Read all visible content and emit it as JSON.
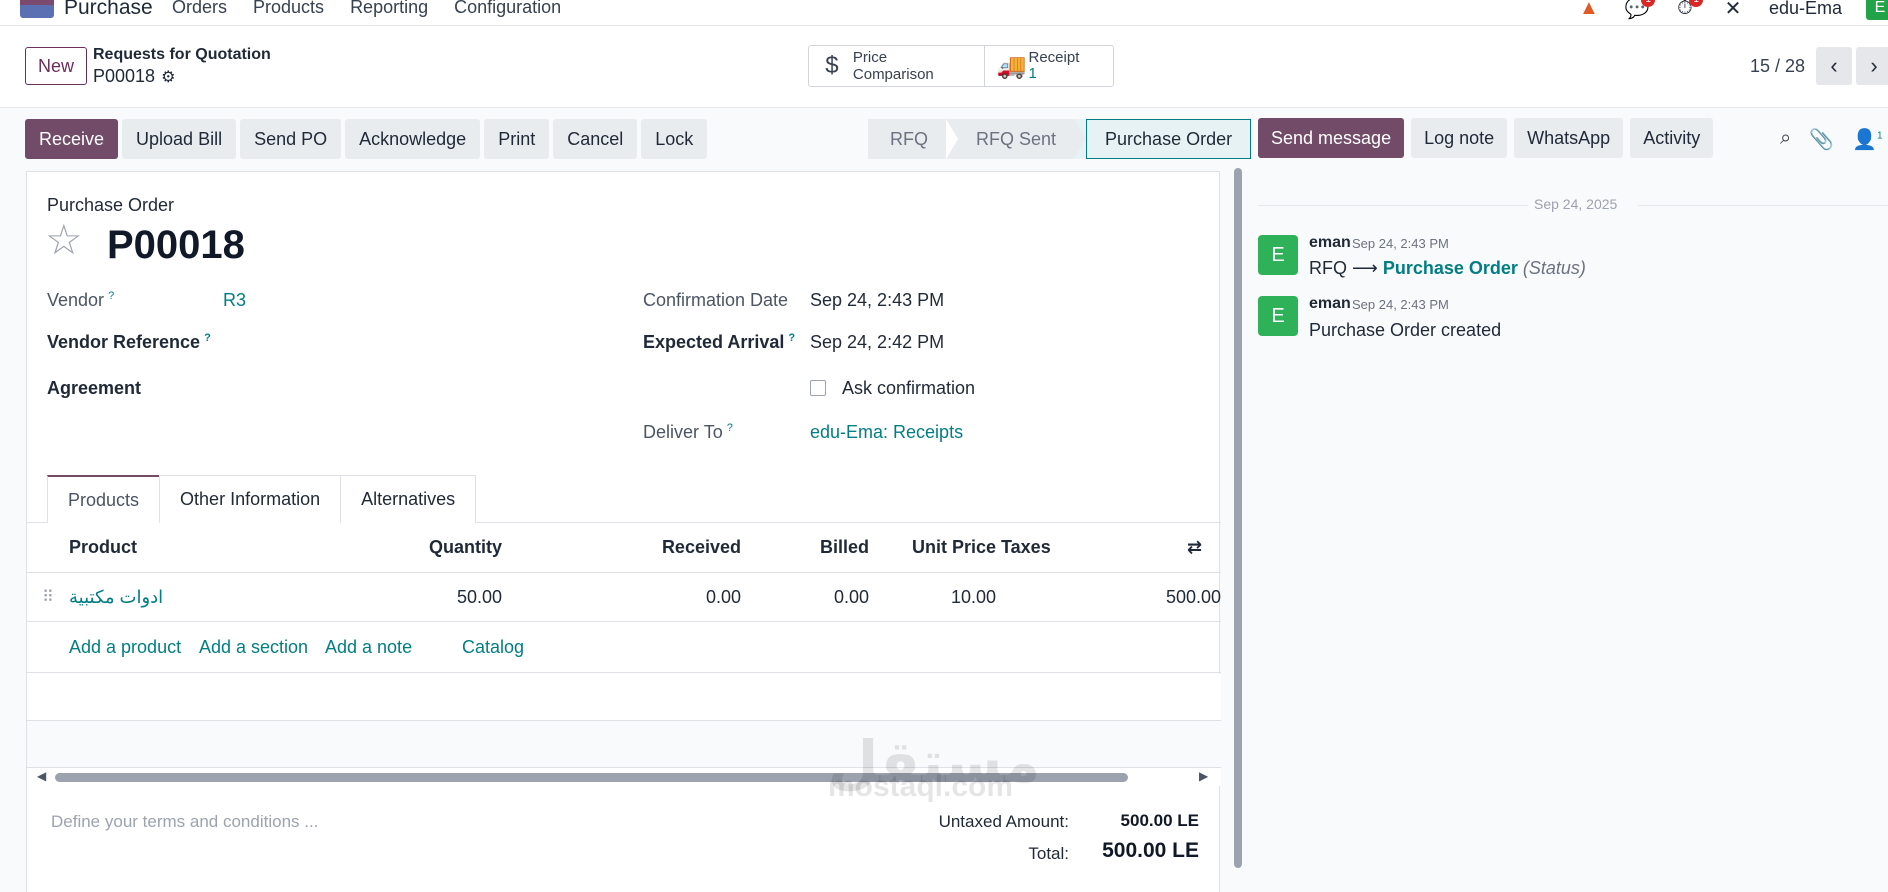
{
  "navbar": {
    "app_name": "Purchase",
    "menu": [
      "Orders",
      "Products",
      "Reporting",
      "Configuration"
    ],
    "messages_badge": "1",
    "activities_badge": "1",
    "user_company": "edu-Ema",
    "user_initial": "E"
  },
  "control_panel": {
    "new_label": "New",
    "breadcrumb_parent": "Requests for Quotation",
    "breadcrumb_current": "P00018",
    "smart_buttons": {
      "price_comparison": "Price Comparison",
      "receipt_label": "Receipt",
      "receipt_count": "1"
    },
    "pager": "15 / 28"
  },
  "actions": [
    "Receive",
    "Upload Bill",
    "Send PO",
    "Acknowledge",
    "Print",
    "Cancel",
    "Lock"
  ],
  "status_stages": [
    "RFQ",
    "RFQ Sent",
    "Purchase Order"
  ],
  "form": {
    "type_label": "Purchase Order",
    "name": "P00018",
    "vendor_label": "Vendor",
    "vendor_value": "R3",
    "vendor_ref_label": "Vendor Reference",
    "agreement_label": "Agreement",
    "confirmation_date_label": "Confirmation Date",
    "confirmation_date_value": "Sep 24, 2:43 PM",
    "expected_arrival_label": "Expected Arrival",
    "expected_arrival_value": "Sep 24, 2:42 PM",
    "ask_confirmation_label": "Ask confirmation",
    "deliver_to_label": "Deliver To",
    "deliver_to_value": "edu-Ema: Receipts",
    "help_mark": "?"
  },
  "tabs": [
    "Products",
    "Other Information",
    "Alternatives"
  ],
  "table": {
    "columns": {
      "product": "Product",
      "quantity": "Quantity",
      "received": "Received",
      "billed": "Billed",
      "unit_price": "Unit Price",
      "taxes": "Taxes"
    },
    "rows": [
      {
        "product": "ادوات مكتبية",
        "quantity": "50.00",
        "received": "0.00",
        "billed": "0.00",
        "unit_price": "10.00",
        "subtotal": "500.00"
      }
    ],
    "add_links": {
      "add_product": "Add a product",
      "add_section": "Add a section",
      "add_note": "Add a note",
      "catalog": "Catalog"
    }
  },
  "footer": {
    "terms_placeholder": "Define your terms and conditions ...",
    "untaxed_label": "Untaxed Amount:",
    "untaxed_value": "500.00 LE",
    "total_label": "Total:",
    "total_value": "500.00 LE"
  },
  "chatter": {
    "buttons": {
      "send_message": "Send message",
      "log_note": "Log note",
      "whatsapp": "WhatsApp",
      "activity": "Activity"
    },
    "followers_count": "1",
    "date_separator": "Sep 24, 2025",
    "messages": [
      {
        "avatar": "E",
        "author": "eman",
        "time": "Sep 24, 2:43 PM",
        "from": "RFQ",
        "to": "Purchase Order",
        "field": "(Status)"
      },
      {
        "avatar": "E",
        "author": "eman",
        "time": "Sep 24, 2:43 PM",
        "body": "Purchase Order created"
      }
    ]
  },
  "watermark": {
    "arabic": "مستقل",
    "latin": "mostaql.com"
  }
}
